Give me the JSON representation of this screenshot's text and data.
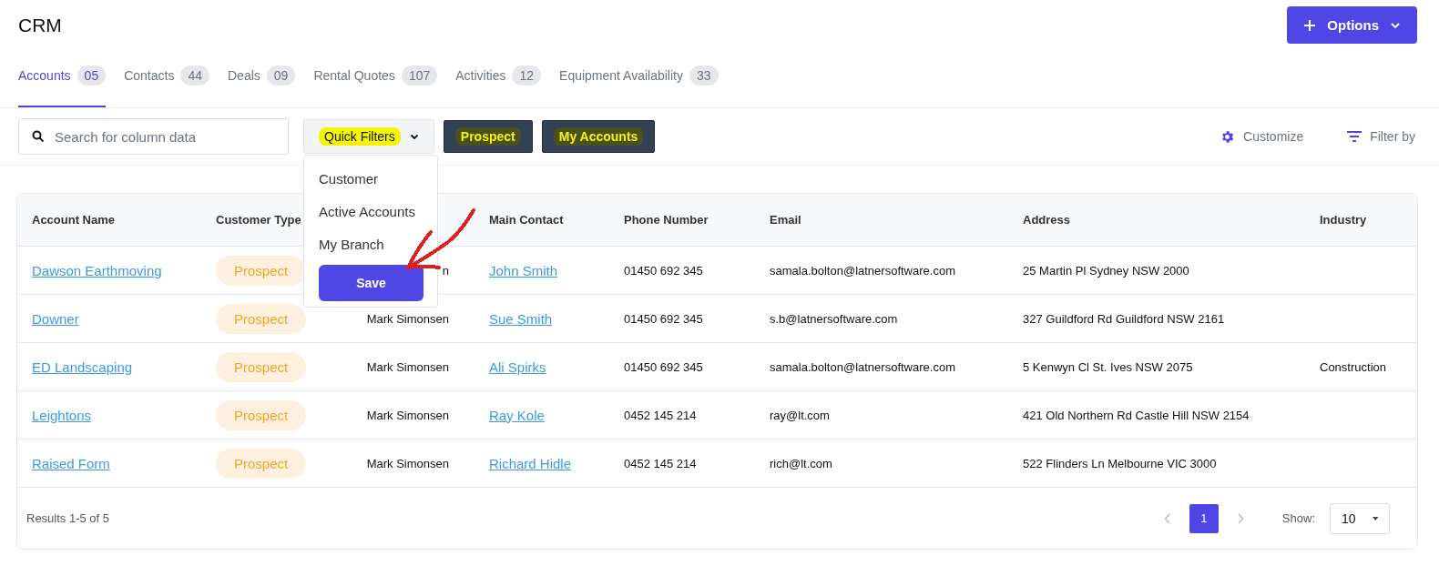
{
  "header": {
    "title": "CRM",
    "options_button": "Options"
  },
  "tabs": [
    {
      "label": "Accounts",
      "count": "05",
      "selected": true
    },
    {
      "label": "Contacts",
      "count": "44",
      "selected": false
    },
    {
      "label": "Deals",
      "count": "09",
      "selected": false
    },
    {
      "label": "Rental Quotes",
      "count": "107",
      "selected": false
    },
    {
      "label": "Activities",
      "count": "12",
      "selected": false
    },
    {
      "label": "Equipment Availability",
      "count": "33",
      "selected": false
    }
  ],
  "toolbar": {
    "search": {
      "placeholder": "Search for column data"
    },
    "quick_filters": {
      "label": "Quick Filters",
      "highlighted": true,
      "expanded": true,
      "items": [
        "Customer",
        "Active Accounts",
        "My Branch"
      ],
      "save_button": "Save"
    },
    "chips": [
      {
        "label": "Prospect",
        "highlighted": true
      },
      {
        "label": "My Accounts",
        "highlighted": true
      }
    ],
    "customize": "Customize",
    "filter_by": "Filter by"
  },
  "table": {
    "columns": [
      {
        "label": "Account Name"
      },
      {
        "label": "Customer Type"
      },
      {},
      {
        "label": "Main Contact"
      },
      {
        "label": "Phone Number"
      },
      {
        "label": "Email"
      },
      {
        "label": "Address"
      },
      {
        "label": "Industry"
      }
    ],
    "rows": [
      {
        "account": "Dawson Earthmoving",
        "type": "Prospect",
        "column_3": "n",
        "contact": "John Smith",
        "phone": "01450 692 345",
        "email": "samala.bolton@latnersoftware.com",
        "address": "25 Martin Pl Sydney NSW 2000"
      },
      {
        "account": "Downer",
        "type": "Prospect",
        "column_3": "Mark Simonsen",
        "contact": "Sue Smith",
        "phone": "01450 692 345",
        "email": "s.b@latnersoftware.com",
        "address": "327 Guildford Rd Guildford NSW 2161"
      },
      {
        "account": "ED Landscaping",
        "type": "Prospect",
        "column_3": "Mark Simonsen",
        "contact": "Ali Spirks",
        "phone": "01450 692 345",
        "email": "samala.bolton@latnersoftware.com",
        "address": "5 Kenwyn Cl St. Ives NSW 2075",
        "industry": "Construction"
      },
      {
        "account": "Leightons",
        "type": "Prospect",
        "column_3": "Mark Simonsen",
        "contact": "Ray Kole",
        "phone": "0452 145 214",
        "email": "ray@lt.com",
        "address": "421 Old Northern Rd Castle Hill NSW 2154"
      },
      {
        "account": "Raised Form",
        "type": "Prospect",
        "column_3": "Mark Simonsen",
        "contact": "Richard Hidle",
        "phone": "0452 145 214",
        "email": "rich@lt.com",
        "address": "522 Flinders Ln Melbourne VIC 3000"
      }
    ]
  },
  "footer": {
    "results": "Results 1-5 of 5",
    "pages": [
      {
        "label": "1",
        "selected": true
      }
    ],
    "show_label": "Show:",
    "page_size": "10"
  },
  "annotations": [
    {
      "kind": "arrow",
      "color": "#e02020"
    }
  ]
}
